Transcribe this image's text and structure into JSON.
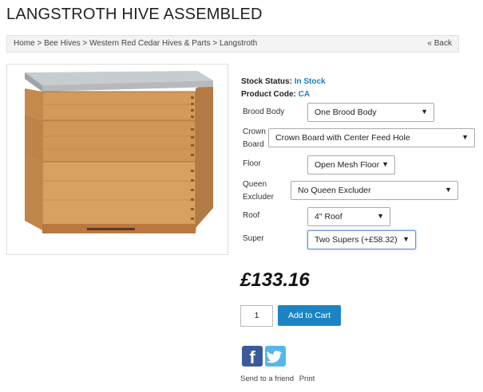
{
  "page": {
    "title": "LANGSTROTH HIVE ASSEMBLED"
  },
  "breadcrumb": {
    "text": "Home > Bee Hives > Western Red Cedar Hives & Parts > Langstroth",
    "back_label": "« Back"
  },
  "stock": {
    "status_label": "Stock Status:",
    "status_value": "In Stock",
    "code_label": "Product Code:",
    "code_value": "CA"
  },
  "options": {
    "brood_body": {
      "label": "Brood Body",
      "value": "One Brood Body"
    },
    "crown_board": {
      "label_line1": "Crown",
      "label_line2": "Board",
      "value": "Crown Board with Center Feed Hole"
    },
    "floor": {
      "label": "Floor",
      "value": "Open Mesh Floor"
    },
    "queen_excluder": {
      "label_line1": "Queen",
      "label_line2": "Excluder",
      "value": "No Queen Excluder"
    },
    "roof": {
      "label": "Roof",
      "value": "4\" Roof"
    },
    "super": {
      "label": "Super",
      "value": "Two Supers (+£58.32)"
    }
  },
  "price": "£133.16",
  "cart": {
    "quantity": "1",
    "add_label": "Add to Cart"
  },
  "share": {
    "facebook_glyph": "f",
    "send_friend": "Send to a friend",
    "print": "Print"
  },
  "colors": {
    "accent": "#1b85c4",
    "link": "#1a7fc1",
    "facebook": "#3a5a9a",
    "twitter": "#55b8e8"
  }
}
